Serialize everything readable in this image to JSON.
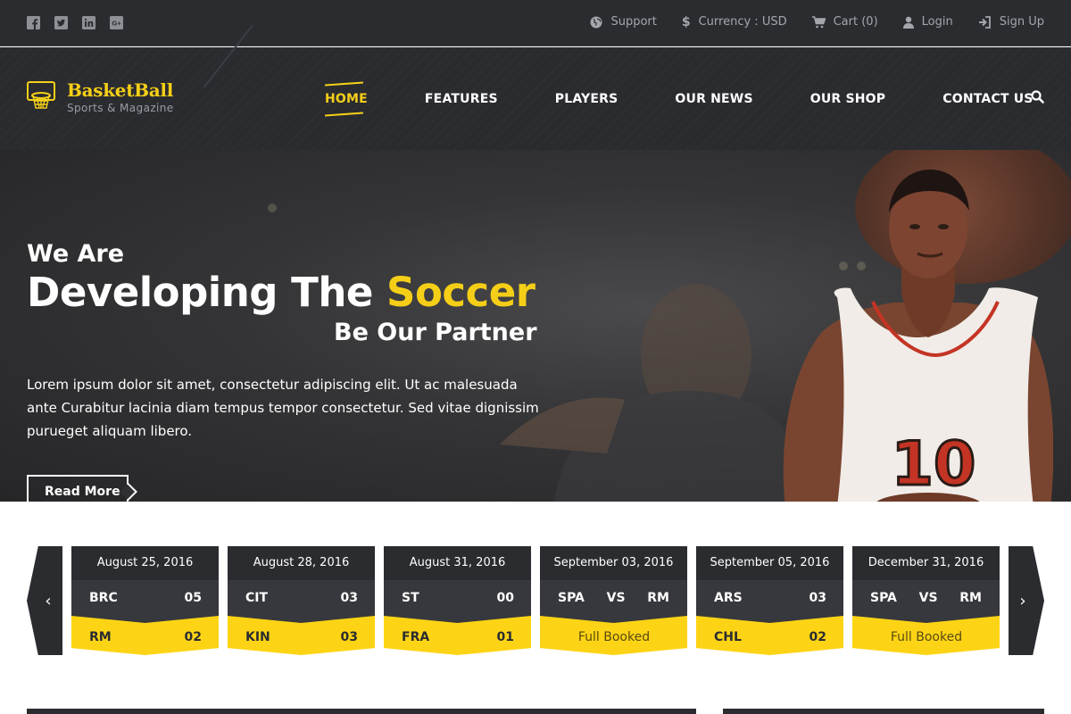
{
  "colors": {
    "accent": "#f5cf17",
    "dark": "#2b2c30",
    "yellow": "#fdd415"
  },
  "topbar": {
    "social_icons": [
      "facebook-icon",
      "twitter-icon",
      "linkedin-icon",
      "google-plus-icon"
    ],
    "links": {
      "support": "Support",
      "currency": "Currency : USD",
      "cart": "Cart (0)",
      "login": "Login",
      "signup": "Sign Up"
    }
  },
  "brand": {
    "title": "BasketBall",
    "subtitle": "Sports & Magazine"
  },
  "menu": {
    "home": "HOME",
    "features": "FEATURES",
    "players": "PLAYERS",
    "news": "OUR NEWS",
    "shop": "OUR SHOP",
    "contact": "CONTACT US"
  },
  "hero": {
    "line1": "We Are",
    "line2_plain": "Developing The ",
    "line2_highlight": "Soccer",
    "line3": "Be Our Partner",
    "body": "Lorem ipsum dolor sit amet, consectetur adipiscing elit. Ut ac malesuada ante Curabitur lacinia diam tempus tempor consectetur. Sed vitae dignissim purueget aliquam libero.",
    "button": "Read More",
    "jersey_number": "10"
  },
  "matches": {
    "prev": "‹",
    "next": "›",
    "m1": {
      "date": "August 25, 2016",
      "team1": "BRC",
      "score1": "05",
      "team2": "RM",
      "score2": "02"
    },
    "m2": {
      "date": "August 28, 2016",
      "team1": "CIT",
      "score1": "03",
      "team2": "KIN",
      "score2": "03"
    },
    "m3": {
      "date": "August 31, 2016",
      "team1": "ST",
      "score1": "00",
      "team2": "FRA",
      "score2": "01"
    },
    "m4": {
      "date": "September 03, 2016",
      "home": "SPA",
      "vs": "VS",
      "away": "RM",
      "status": "Full Booked"
    },
    "m5": {
      "date": "September 05, 2016",
      "team1": "ARS",
      "score1": "03",
      "team2": "CHL",
      "score2": "02"
    },
    "m6": {
      "date": "December 31, 2016",
      "home": "SPA",
      "vs": "VS",
      "away": "RM",
      "status": "Full Booked"
    }
  }
}
